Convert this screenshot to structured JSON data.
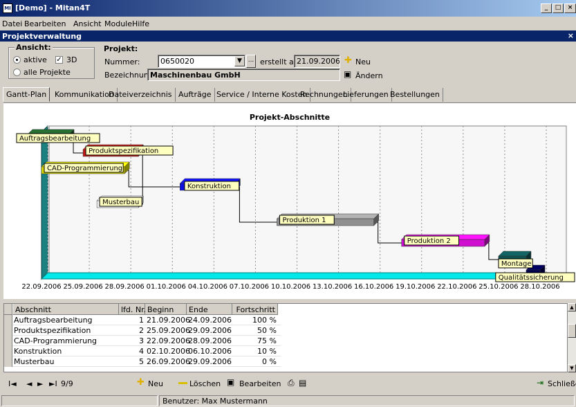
{
  "window": {
    "title": "[Demo] - Mitan4T",
    "app_icon": "MI",
    "controls": [
      "_",
      "□",
      "×"
    ]
  },
  "menu": [
    "Datei",
    "Bearbeiten",
    "Ansicht",
    "Module",
    "Hilfe"
  ],
  "subwindow": {
    "title": "Projektverwaltung",
    "close": "×"
  },
  "view": {
    "group_label": "Ansicht:",
    "active_label": "aktive",
    "all_label": "alle Projekte",
    "three_d_label": "3D",
    "active_selected": true,
    "three_d_checked": true
  },
  "project": {
    "label": "Projekt:",
    "number_label": "Nummer:",
    "number_value": "0650020",
    "created_label": "erstellt am:",
    "created_value": "21.09.2006",
    "name_label": "Bezeichnung",
    "name_value": "Maschinenbau GmbH",
    "new_label": "Neu",
    "edit_label": "Ändern",
    "browse_label": "..."
  },
  "tabs": [
    "Gantt-Plan",
    "Kommunikation",
    "Dateiverzeichnis",
    "Aufträge",
    "Service / Interne Kosten",
    "Rechnungen",
    "Lieferungen",
    "Bestellungen"
  ],
  "chart_data": {
    "type": "gantt",
    "title": "Projekt-Abschnitte",
    "date_ticks": [
      "22.09.2006",
      "25.09.2006",
      "28.09.2006",
      "01.10.2006",
      "04.10.2006",
      "07.10.2006",
      "10.10.2006",
      "13.10.2006",
      "16.10.2006",
      "19.10.2006",
      "22.10.2006",
      "25.10.2006",
      "28.10.2006"
    ],
    "x_start": "21.09.2006",
    "x_end": "29.10.2006",
    "tasks": [
      {
        "name": "Auftragsbearbeitung",
        "start": "21.09.2006",
        "end": "24.09.2006",
        "color": "#1f5a2a",
        "label_at": "start"
      },
      {
        "name": "Produktspezifikation",
        "start": "25.09.2006",
        "end": "29.09.2006",
        "color": "#c41818",
        "label_at": "start"
      },
      {
        "name": "CAD-Programmierung",
        "start": "22.09.2006",
        "end": "28.09.2006",
        "color": "#d8d800",
        "label_at": "start"
      },
      {
        "name": "Musterbau",
        "start": "26.09.2006",
        "end": "29.09.2006",
        "color": "#f2f2f2",
        "label_at": "start"
      },
      {
        "name": "Konstruktion",
        "start": "02.10.2006",
        "end": "06.10.2006",
        "color": "#1010e0",
        "label_at": "mid"
      },
      {
        "name": "Produktion 1",
        "start": "09.10.2006",
        "end": "16.10.2006",
        "color": "#909090",
        "label_at": "start"
      },
      {
        "name": "Produktion 2",
        "start": "18.10.2006",
        "end": "24.10.2006",
        "color": "#d010d0",
        "label_at": "start"
      },
      {
        "name": "Montage",
        "start": "25.10.2006",
        "end": "27.10.2006",
        "color": "#0f5050",
        "label_at": "start"
      },
      {
        "name": "Qualitätssicherung",
        "start": "27.10.2006",
        "end": "28.10.2006",
        "color": "#000050",
        "label_at": "below"
      }
    ],
    "links": [
      [
        0,
        1
      ],
      [
        1,
        4
      ],
      [
        2,
        4
      ],
      [
        3,
        4
      ],
      [
        4,
        5
      ],
      [
        5,
        6
      ],
      [
        6,
        7
      ],
      [
        7,
        8
      ]
    ]
  },
  "grid": {
    "headers": [
      "Abschnitt",
      "lfd. Nr.",
      "Beginn",
      "Ende",
      "Fortschritt"
    ],
    "rows": [
      [
        "Auftragsbearbeitung",
        "1",
        "21.09.2006",
        "24.09.2006",
        "100 %"
      ],
      [
        "Produktspezifikation",
        "2",
        "25.09.2006",
        "29.09.2006",
        "50 %"
      ],
      [
        "CAD-Programmierung",
        "3",
        "22.09.2006",
        "28.09.2006",
        "75 %"
      ],
      [
        "Konstruktion",
        "4",
        "02.10.2006",
        "06.10.2006",
        "10 %"
      ],
      [
        "Musterbau",
        "5",
        "26.09.2006",
        "29.09.2006",
        "0 %"
      ]
    ]
  },
  "navbar": {
    "first": "I◄",
    "prev": "◄",
    "next": "►",
    "last": "►I",
    "record": "9/9",
    "new_label": "Neu",
    "delete_label": "Löschen",
    "edit_label": "Bearbeiten",
    "close_label": "Schließen"
  },
  "status": {
    "user": "Benutzer: Max Mustermann"
  }
}
